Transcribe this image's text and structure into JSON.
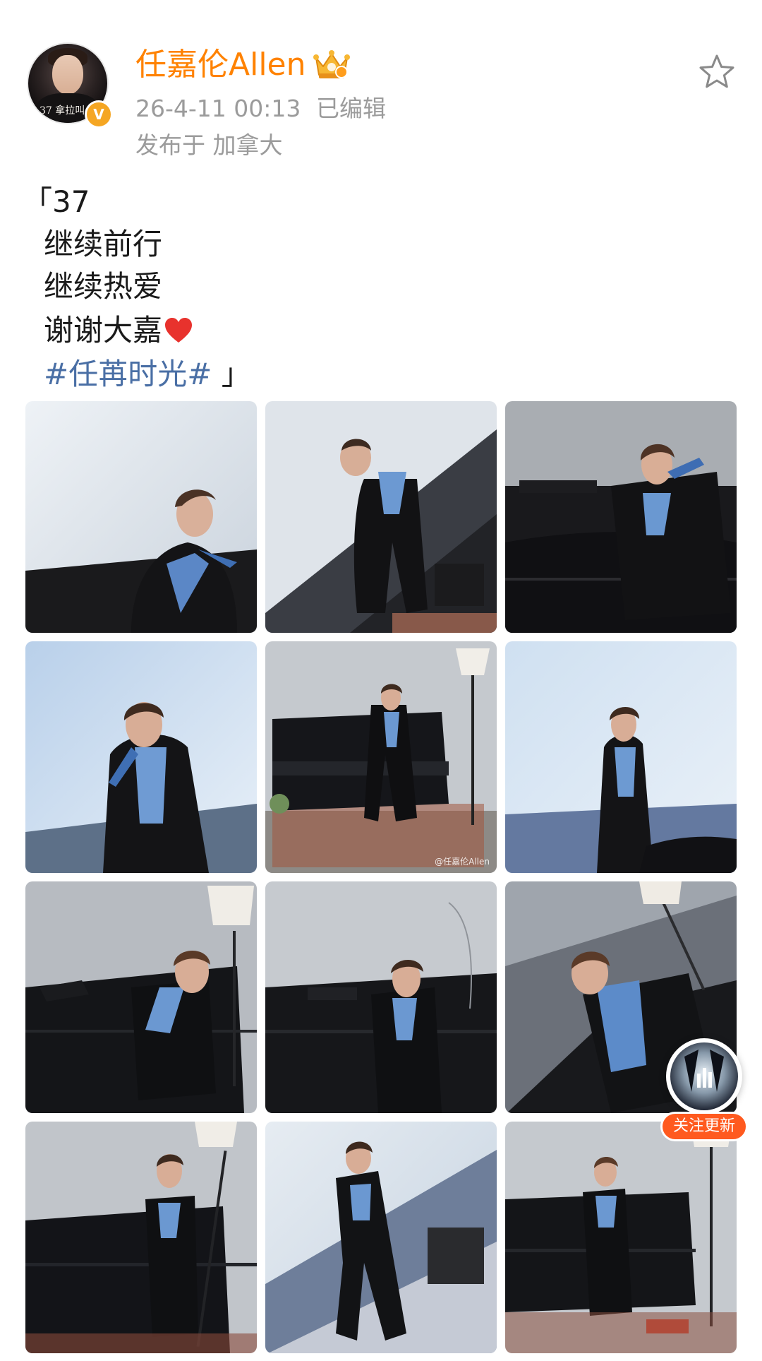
{
  "post": {
    "author": {
      "avatar_caption": "37 拿拉叫",
      "verified_badge": "V",
      "name": "任嘉伦Allen"
    },
    "meta": {
      "time": "26-4-11 00:13",
      "edited": "已编辑",
      "location": "发布于 加拿大"
    },
    "text": {
      "line1": "「37",
      "line2": "继续前行",
      "line3": "继续热爱",
      "line4": "谢谢大嘉",
      "hashtag": "#任苒时光#",
      "close_quote": "」"
    },
    "images": {
      "watermark": "@任嘉伦Allen"
    }
  },
  "floating_follow": {
    "button_label": "关注更新"
  },
  "icons": {
    "favorite": "star-outline-icon",
    "membership": "crown-icon",
    "heart": "red-heart-emoji"
  },
  "colors": {
    "username": "#ff8200",
    "hashtag": "#4a6fa5",
    "meta_text": "#9b9b9b",
    "verified": "#f5a623",
    "follow_button": "#ff5a1f"
  }
}
